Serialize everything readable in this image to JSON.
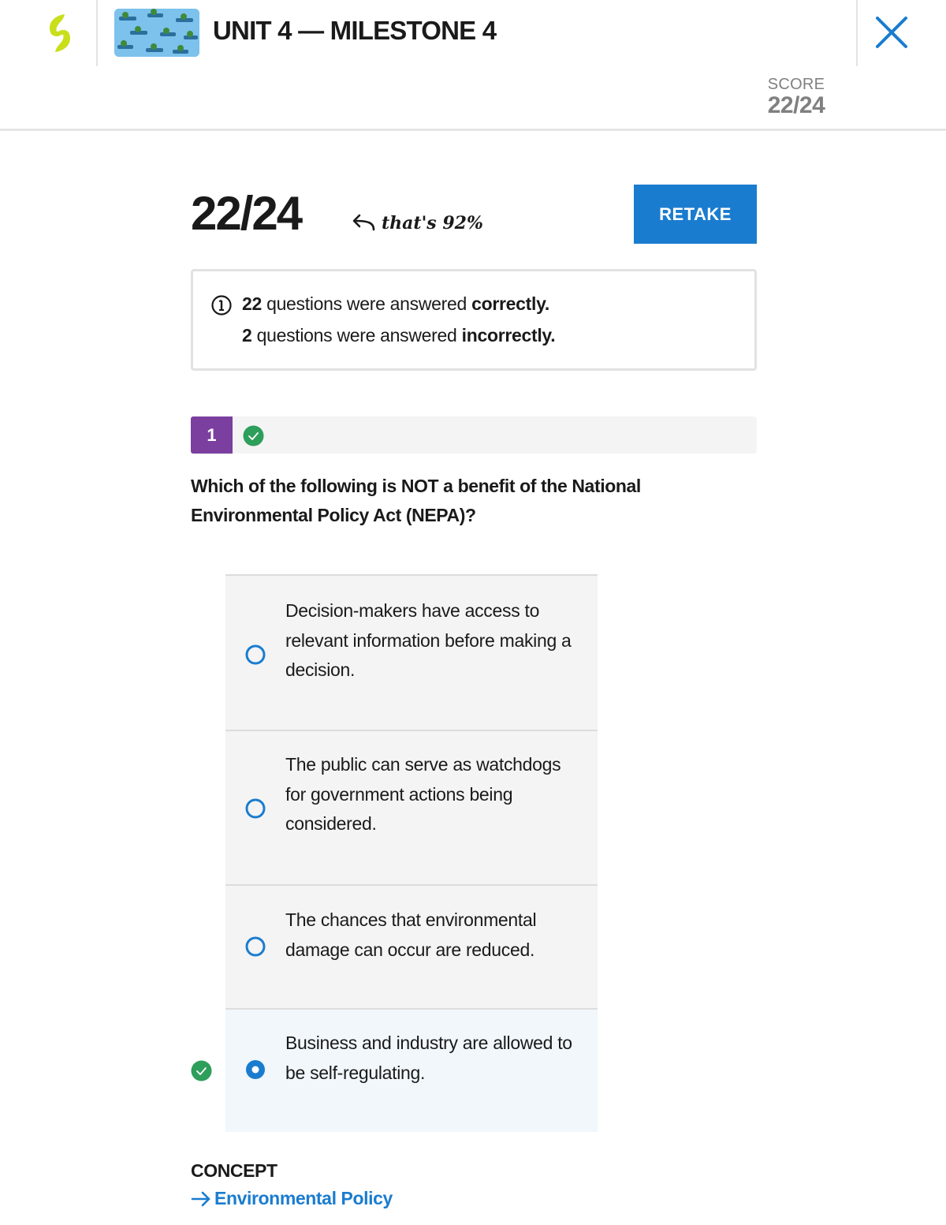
{
  "header": {
    "title": "UNIT 4 — MILESTONE 4",
    "logo_icon": "sophia-logo-icon",
    "close_icon": "close-icon",
    "score_label": "SCORE",
    "score_value": "22/24"
  },
  "result": {
    "score": "22/24",
    "percent_note": "that's 92%",
    "retake_label": "RETAKE"
  },
  "summary": {
    "correct_count": "22",
    "correct_text": "questions were answered",
    "correct_word": "correctly.",
    "incorrect_count": "2",
    "incorrect_text": "questions were answered",
    "incorrect_word": "incorrectly."
  },
  "question": {
    "number": "1",
    "status": "correct",
    "text": "Which of the following is NOT a benefit of the National Environmental Policy Act (NEPA)?",
    "options": [
      {
        "text": "Decision-makers have access to relevant information before making a decision.",
        "selected": false
      },
      {
        "text": "The public can serve as watchdogs for government actions being considered.",
        "selected": false
      },
      {
        "text": "The chances that environmental damage can occur are reduced.",
        "selected": false
      },
      {
        "text": "Business and industry are allowed to be self-regulating.",
        "selected": true,
        "correct": true
      }
    ]
  },
  "concept": {
    "label": "CONCEPT",
    "link_text": "Environmental Policy"
  },
  "colors": {
    "accent_blue": "#1a7ccf",
    "purple": "#7b3fa0",
    "green": "#2e9e5b",
    "logo_yellow": "#c9df1c"
  }
}
